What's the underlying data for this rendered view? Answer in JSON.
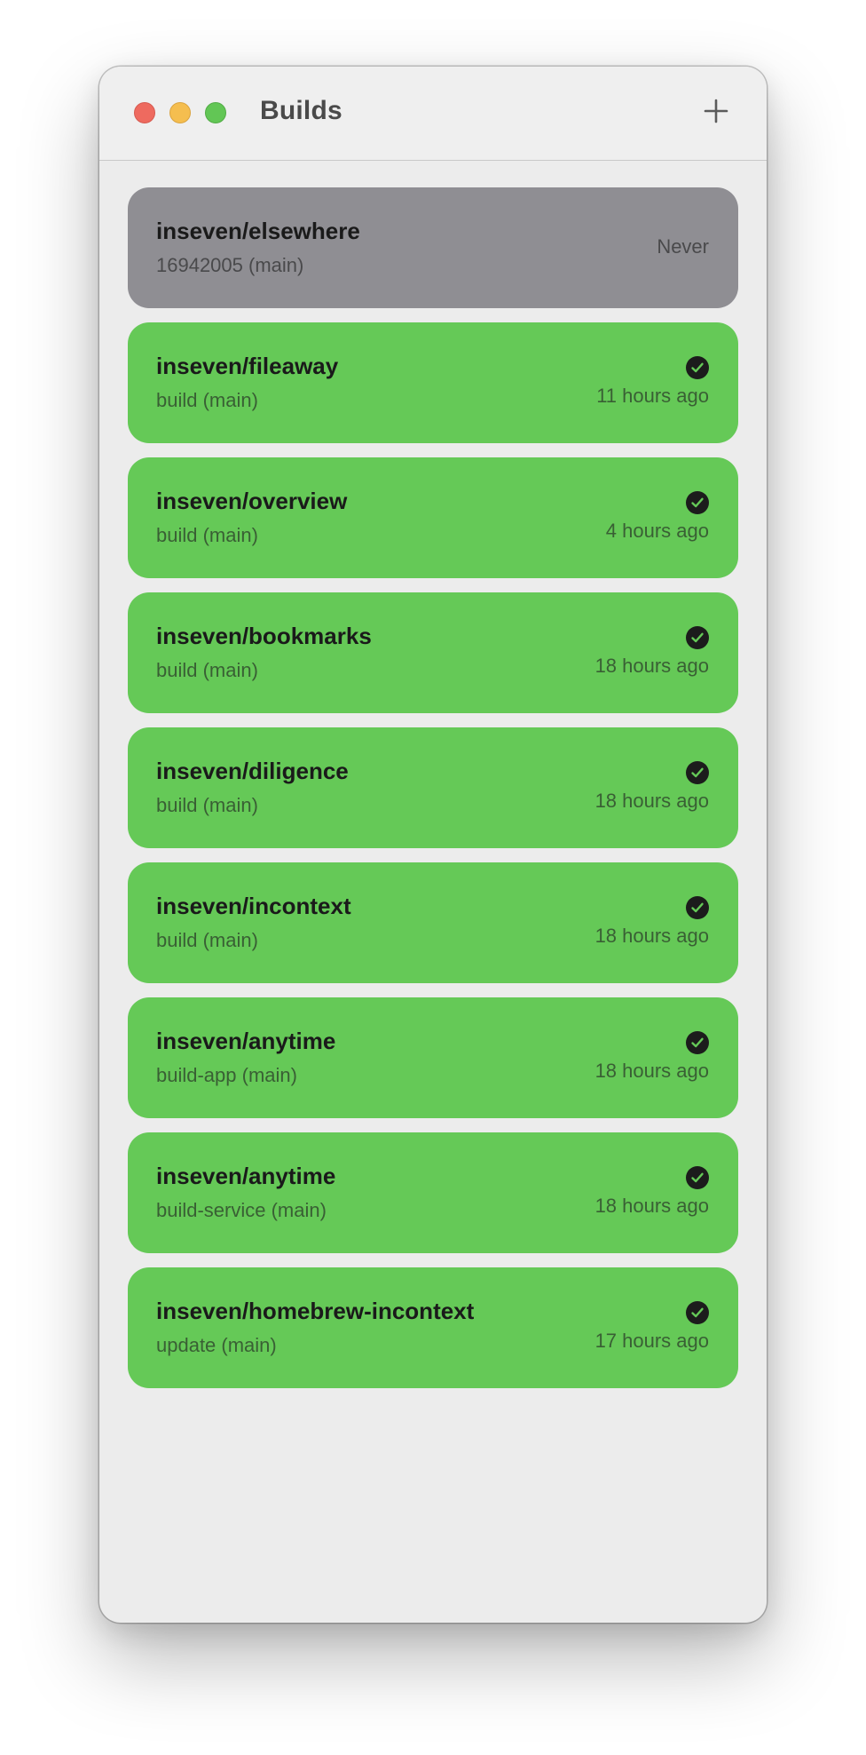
{
  "window": {
    "title": "Builds",
    "add_icon": "plus-icon"
  },
  "colors": {
    "success": "#65c957",
    "none": "#8f8e93"
  },
  "builds": [
    {
      "repo": "inseven/elsewhere",
      "workflow": "16942005 (main)",
      "status": "none",
      "time": "Never"
    },
    {
      "repo": "inseven/fileaway",
      "workflow": "build (main)",
      "status": "success",
      "time": "11 hours ago"
    },
    {
      "repo": "inseven/overview",
      "workflow": "build (main)",
      "status": "success",
      "time": "4 hours ago"
    },
    {
      "repo": "inseven/bookmarks",
      "workflow": "build (main)",
      "status": "success",
      "time": "18 hours ago"
    },
    {
      "repo": "inseven/diligence",
      "workflow": "build (main)",
      "status": "success",
      "time": "18 hours ago"
    },
    {
      "repo": "inseven/incontext",
      "workflow": "build (main)",
      "status": "success",
      "time": "18 hours ago"
    },
    {
      "repo": "inseven/anytime",
      "workflow": "build-app (main)",
      "status": "success",
      "time": "18 hours ago"
    },
    {
      "repo": "inseven/anytime",
      "workflow": "build-service (main)",
      "status": "success",
      "time": "18 hours ago"
    },
    {
      "repo": "inseven/homebrew-incontext",
      "workflow": "update (main)",
      "status": "success",
      "time": "17 hours ago"
    }
  ]
}
